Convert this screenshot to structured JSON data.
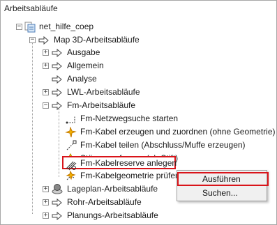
{
  "panel": {
    "title": "Arbeitsabläufe"
  },
  "tree": {
    "root": "net_hilfe_coep",
    "map": "Map 3D-Arbeitsabläufe",
    "ausgabe": "Ausgabe",
    "allgemein": "Allgemein",
    "analyse": "Analyse",
    "lwl": "LWL-Arbeitsabläufe",
    "fm": "Fm-Arbeitsabläufe",
    "fm_items": [
      "Fm-Netzwegsuche starten",
      "Fm-Kabel erzeugen und zuordnen (ohne Geometrie)",
      "Fm-Kabel teilen (Abschluss/Muffe erzeugen)",
      "Störung erfassen (ab Stift)",
      "Fm-Kabelreserve anlegen",
      "Fm-Kabelgeometrie prüfen"
    ],
    "lageplan": "Lageplan-Arbeitsabläufe",
    "rohr": "Rohr-Arbeitsabläufe",
    "planung": "Planungs-Arbeitsabläufe"
  },
  "context_menu": {
    "items": [
      "Ausführen",
      "Suchen..."
    ]
  },
  "colors": {
    "highlight": "#d9141a",
    "accent": "#1f63c6"
  }
}
